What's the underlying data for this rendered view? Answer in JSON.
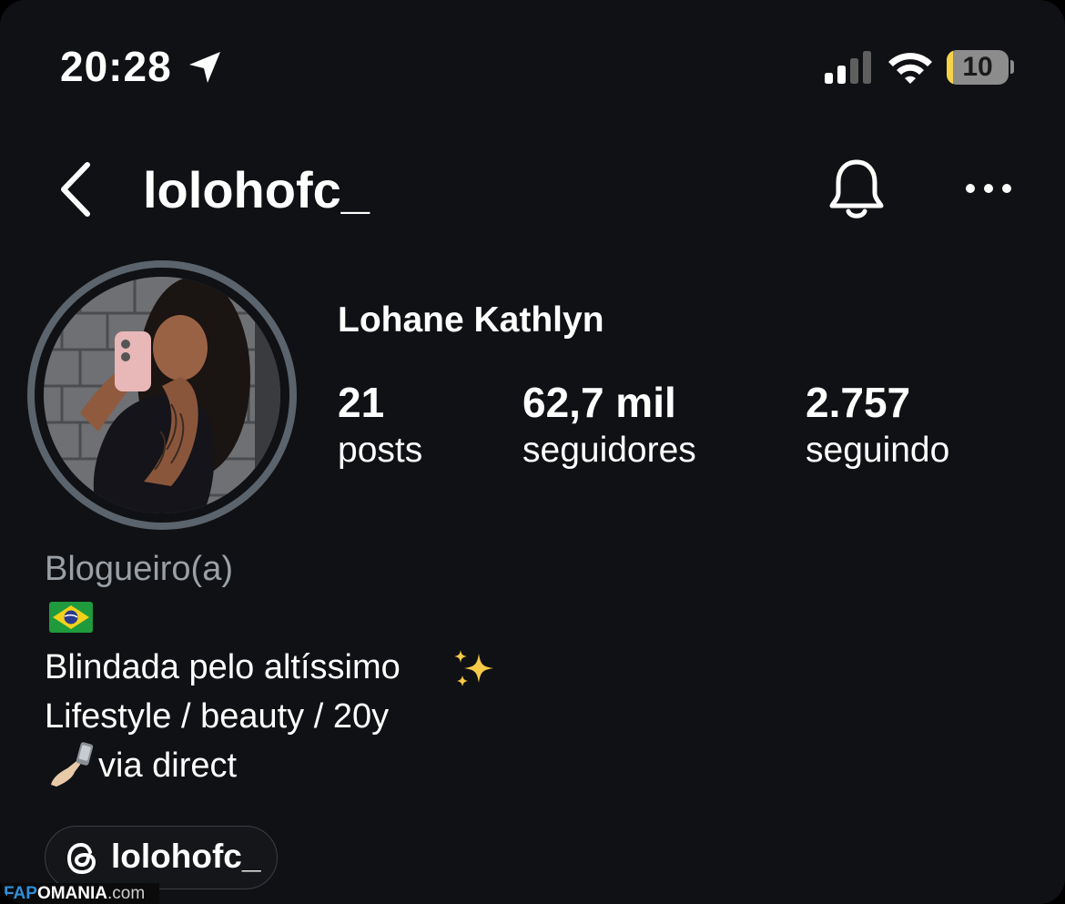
{
  "status_bar": {
    "time": "20:28",
    "battery_level": "10",
    "battery_fraction": 0.1,
    "icons": [
      "location-arrow-icon",
      "cellular-signal-icon",
      "wifi-icon",
      "battery-icon"
    ]
  },
  "header": {
    "username": "lolohofc_",
    "icons": [
      "chevron-left-icon",
      "bell-icon",
      "more-horizontal-icon"
    ]
  },
  "profile": {
    "display_name": "Lohane Kathlyn",
    "stats": [
      {
        "value": "21",
        "label": "posts"
      },
      {
        "value": "62,7 mil",
        "label": "seguidores"
      },
      {
        "value": "2.757",
        "label": "seguindo"
      }
    ],
    "category": "Blogueiro(a)",
    "bio_lines": [
      "Blindada pelo altíssimo",
      "Lifestyle / beauty / 20y",
      "via direct"
    ],
    "bio_icons": [
      "brazil-flag-icon",
      "sparkles-icon",
      "selfie-hand-icon"
    ]
  },
  "threads_link": {
    "label": "lolohofc_",
    "icon": "threads-icon"
  },
  "watermark": {
    "part1": "FAP",
    "part2": "OMANIA",
    "part3": ".com"
  },
  "colors": {
    "background": "#0f1114",
    "text": "#ffffff",
    "muted": "#9aa0a6",
    "avatar_ring": "#5b636c",
    "battery_fill": "#f5d24a",
    "watermark_accent": "#2f8fd8"
  }
}
